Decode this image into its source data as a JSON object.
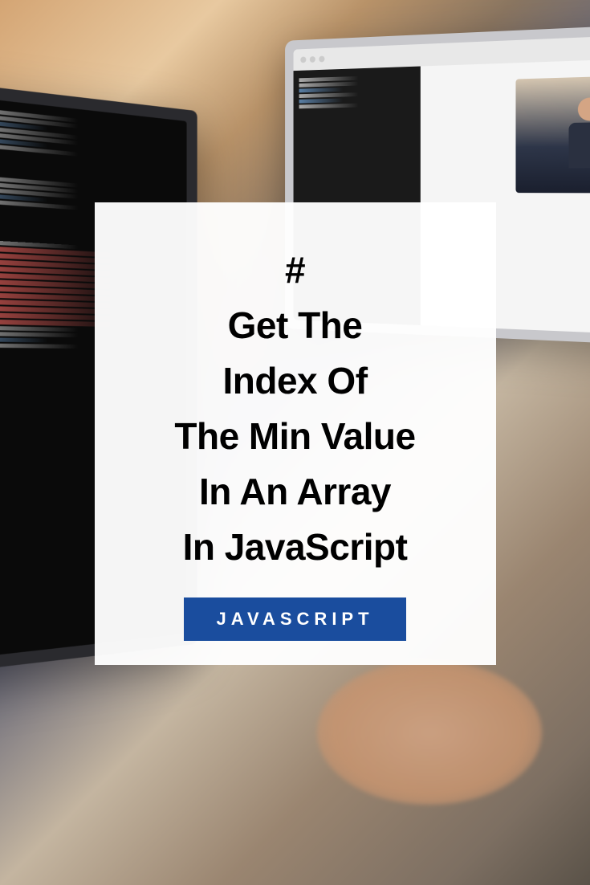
{
  "title": {
    "hash": "#",
    "line1": "Get The",
    "line2": "Index Of",
    "line3": "The Min Value",
    "line4": "In An Array",
    "line5": "In JavaScript"
  },
  "category": "JAVASCRIPT",
  "colors": {
    "badge_bg": "#1a4d9e",
    "badge_text": "#ffffff",
    "card_bg": "rgba(255,255,255,0.96)",
    "title_color": "#000000"
  }
}
